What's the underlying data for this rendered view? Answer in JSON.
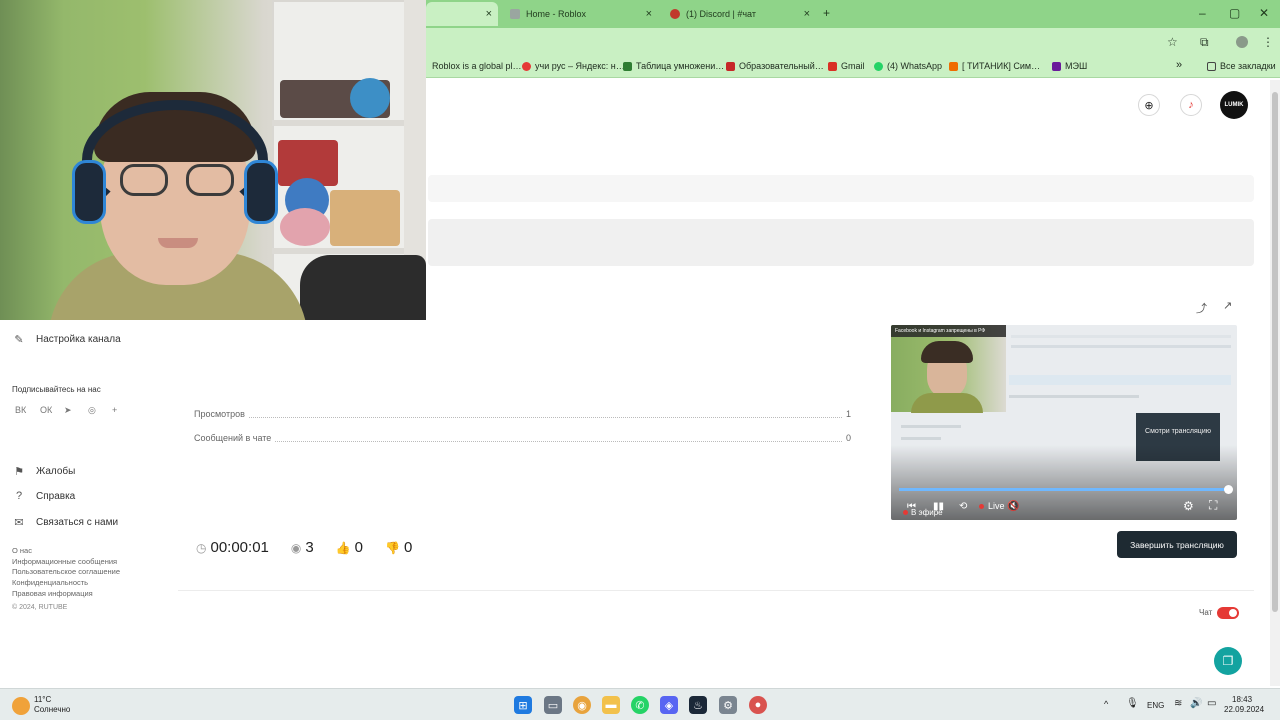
{
  "browser": {
    "tabs": [
      {
        "label": "",
        "close": "×"
      },
      {
        "label": "Home - Roblox",
        "close": "×"
      },
      {
        "label": "(1) Discord | #чат",
        "close": "×"
      }
    ],
    "new_tab": "+",
    "window_controls": [
      "–",
      "▢",
      "✕"
    ],
    "bookmarks": [
      "Roblox is a global pl…",
      "учи рус – Яндекс: н…",
      "Таблица умножени…",
      "Образовательный…",
      "Gmail",
      "(4) WhatsApp",
      "[ ТИТАНИК] Сим…",
      "МЭШ"
    ],
    "bookmarks_more": "»",
    "all_bookmarks": "Все закладки"
  },
  "header": {
    "avatar_text": "LUMIK"
  },
  "sidebar": {
    "channel_settings": "Настройка канала",
    "subscribe_title": "Подписывайтесь на нас",
    "social_icons": [
      "vk-icon",
      "ok-icon",
      "telegram-icon",
      "viber-icon",
      "plus-icon"
    ],
    "items": [
      {
        "label": "Жалобы",
        "icon": "flag-icon"
      },
      {
        "label": "Справка",
        "icon": "question-icon"
      },
      {
        "label": "Связаться с нами",
        "icon": "chat-icon"
      }
    ],
    "footer_links": [
      "О нас",
      "Информационные сообщения",
      "Пользовательское соглашение",
      "Конфиденциальность",
      "Правовая информация"
    ],
    "copyright": "© 2024, RUTUBE"
  },
  "stats": {
    "views_label": "Просмотров",
    "views_value": "1",
    "chat_messages_label": "Сообщений в чате",
    "chat_messages_value": "0"
  },
  "counters": {
    "duration": "00:00:01",
    "viewers": "3",
    "likes": "0",
    "dislikes": "0"
  },
  "player": {
    "cam_banner": "Facebook и Instagram запрещены в РФ",
    "watch_card": "Смотри трансляцию",
    "on_air": "В эфире",
    "live": "Live",
    "progress": 1.0
  },
  "actions": {
    "end_stream": "Завершить трансляцию"
  },
  "chat": {
    "label": "Чат",
    "enabled": true
  },
  "taskbar": {
    "weather_temp": "11°C",
    "weather_text": "Солнечно",
    "lang": "ENG",
    "time": "18:43",
    "date": "22.09.2024"
  },
  "colors": {
    "tabbar": "#8fd489",
    "toolbar": "#c9f0c3",
    "toggle_on": "#e53935",
    "help_fab": "#13a3a0"
  }
}
